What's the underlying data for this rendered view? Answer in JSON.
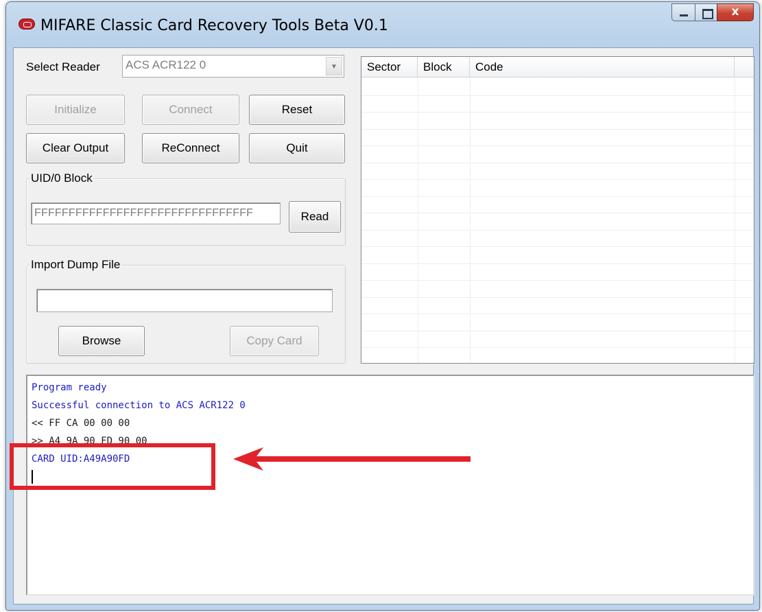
{
  "window": {
    "title": "MIFARE Classic Card Recovery Tools Beta V0.1",
    "icons": [
      "app-icon",
      "minimize-icon",
      "maximize-icon",
      "close-icon"
    ],
    "close_glyph": "x"
  },
  "reader": {
    "label": "Select Reader",
    "selected": "ACS ACR122 0"
  },
  "buttons": {
    "initialize": "Initialize",
    "connect": "Connect",
    "reset": "Reset",
    "clear_output": "Clear Output",
    "reconnect": "ReConnect",
    "quit": "Quit",
    "read": "Read",
    "browse": "Browse",
    "copy_card": "Copy Card"
  },
  "uid_group": {
    "legend": "UID/0 Block",
    "value": "FFFFFFFFFFFFFFFFFFFFFFFFFFFFFFFF"
  },
  "import_group": {
    "legend": "Import Dump File",
    "value": ""
  },
  "grid": {
    "columns": [
      "Sector",
      "Block",
      "Code"
    ],
    "rows": []
  },
  "output": {
    "lines": [
      {
        "text": "Program ready",
        "color": "blue"
      },
      {
        "text": "Successful connection to ACS ACR122 0",
        "color": "blue"
      },
      {
        "text": "<< FF CA 00 00 00",
        "color": "black"
      },
      {
        "text": ">> A4 9A 90 FD 90 00",
        "color": "black"
      },
      {
        "text": "CARD UID:A49A90FD",
        "color": "blue"
      }
    ]
  },
  "annotation": {
    "highlight_color": "#e0222a"
  },
  "colors": {
    "output_blue": "#1c1cc2",
    "disabled_text": "#a0a0a0"
  }
}
